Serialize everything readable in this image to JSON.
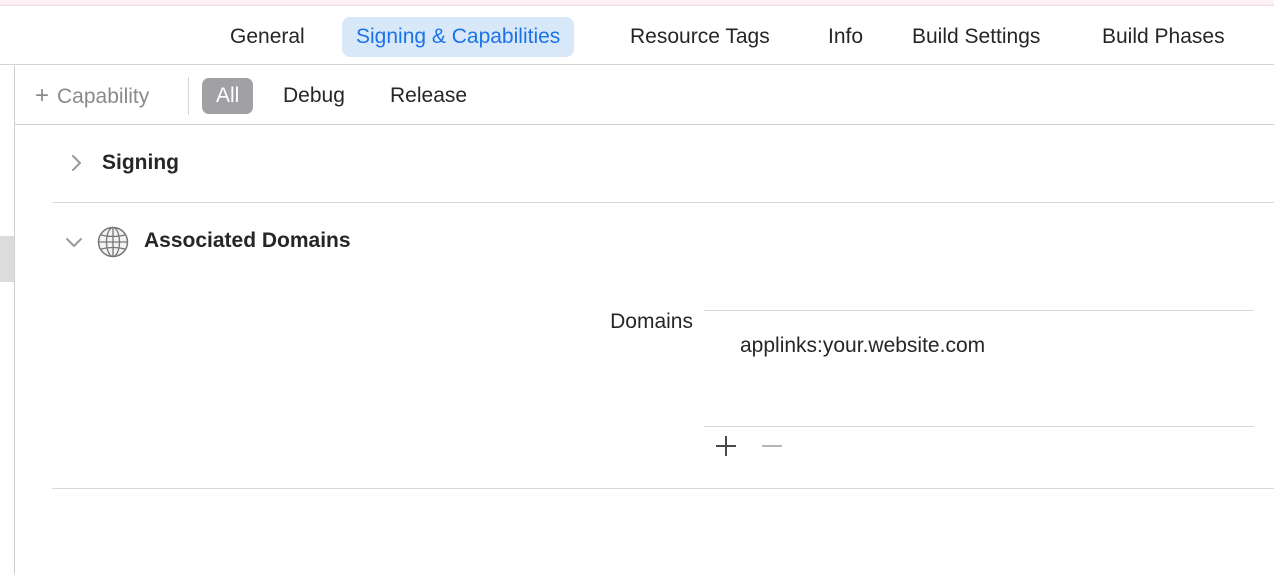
{
  "tabs": [
    {
      "label": "General",
      "selected": false
    },
    {
      "label": "Signing & Capabilities",
      "selected": true
    },
    {
      "label": "Resource Tags",
      "selected": false
    },
    {
      "label": "Info",
      "selected": false
    },
    {
      "label": "Build Settings",
      "selected": false
    },
    {
      "label": "Build Phases",
      "selected": false
    }
  ],
  "toolbar": {
    "add_capability_label": "Capability",
    "add_capability_icon": "plus-icon",
    "filters": [
      {
        "label": "All",
        "selected": true
      },
      {
        "label": "Debug",
        "selected": false
      },
      {
        "label": "Release",
        "selected": false
      }
    ]
  },
  "sections": {
    "signing": {
      "title": "Signing",
      "expanded": false,
      "icon": "chevron-right-icon"
    },
    "associated_domains": {
      "title": "Associated Domains",
      "expanded": true,
      "icon": "globe-icon",
      "domains_label": "Domains",
      "domains": [
        "applinks:your.website.com"
      ],
      "add_icon": "plus-icon",
      "remove_icon": "minus-icon"
    }
  },
  "colors": {
    "accent": "#1a73e8",
    "selected_tab_bg": "#d8e8f9",
    "selected_filter_bg": "#a0a0a5",
    "separator": "#d9d9d9"
  }
}
